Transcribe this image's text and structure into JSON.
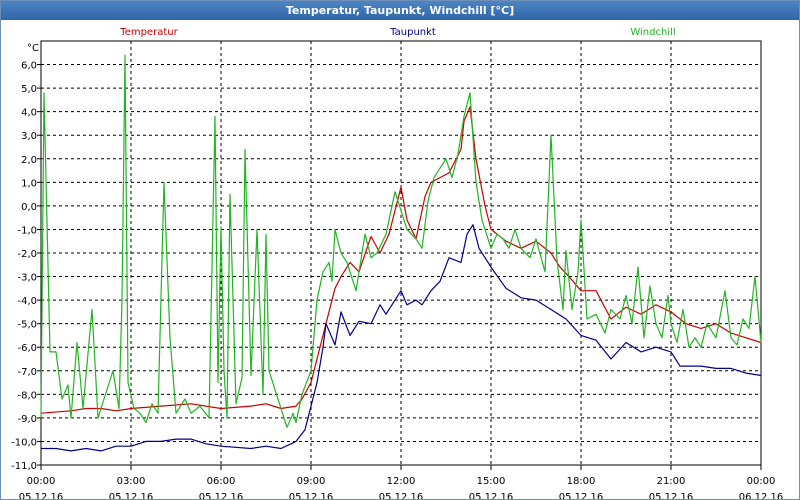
{
  "window": {
    "title": "Temperatur, Taupunkt, Windchill [°C]"
  },
  "chart_data": {
    "type": "line",
    "title": "Temperatur, Taupunkt, Windchill [°C]",
    "y_unit": "°C",
    "ylim": [
      -11,
      7
    ],
    "y_ticks": [
      "6,0",
      "5,0",
      "4,0",
      "3,0",
      "2,0",
      "1,0",
      "0,0",
      "-1,0",
      "-2,0",
      "-3,0",
      "-4,0",
      "-5,0",
      "-6,0",
      "-7,0",
      "-8,0",
      "-9,0",
      "-10,0",
      "-11,0"
    ],
    "y_tick_values": [
      6,
      5,
      4,
      3,
      2,
      1,
      0,
      -1,
      -2,
      -3,
      -4,
      -5,
      -6,
      -7,
      -8,
      -9,
      -10,
      -11
    ],
    "x_range_hours": [
      0,
      24
    ],
    "x_ticks": [
      {
        "hour": 0,
        "time": "00:00",
        "date": "05.12.16"
      },
      {
        "hour": 3,
        "time": "03:00",
        "date": "05.12.16"
      },
      {
        "hour": 6,
        "time": "06:00",
        "date": "05.12.16"
      },
      {
        "hour": 9,
        "time": "09:00",
        "date": "05.12.16"
      },
      {
        "hour": 12,
        "time": "12:00",
        "date": "05.12.16"
      },
      {
        "hour": 15,
        "time": "15:00",
        "date": "05.12.16"
      },
      {
        "hour": 18,
        "time": "18:00",
        "date": "05.12.16"
      },
      {
        "hour": 21,
        "time": "21:00",
        "date": "05.12.16"
      },
      {
        "hour": 24,
        "time": "00:00",
        "date": "06.12.16"
      }
    ],
    "grid": true,
    "legend_position": "top",
    "series": [
      {
        "name": "Temperatur",
        "color": "#cc0000",
        "points": [
          [
            0,
            -8.8
          ],
          [
            1,
            -8.7
          ],
          [
            1.5,
            -8.6
          ],
          [
            2,
            -8.6
          ],
          [
            2.5,
            -8.7
          ],
          [
            3,
            -8.6
          ],
          [
            4,
            -8.5
          ],
          [
            5,
            -8.4
          ],
          [
            6,
            -8.6
          ],
          [
            7,
            -8.5
          ],
          [
            7.5,
            -8.4
          ],
          [
            8,
            -8.6
          ],
          [
            8.5,
            -8.5
          ],
          [
            8.7,
            -8.2
          ],
          [
            9,
            -7.5
          ],
          [
            9.2,
            -6.5
          ],
          [
            9.5,
            -5
          ],
          [
            9.8,
            -3.5
          ],
          [
            10,
            -3
          ],
          [
            10.3,
            -2.4
          ],
          [
            10.6,
            -2.8
          ],
          [
            11,
            -1.3
          ],
          [
            11.3,
            -2
          ],
          [
            11.6,
            -1.2
          ],
          [
            12,
            0.8
          ],
          [
            12.2,
            -0.6
          ],
          [
            12.5,
            -1.4
          ],
          [
            12.8,
            0.4
          ],
          [
            13,
            1
          ],
          [
            13.3,
            1.2
          ],
          [
            13.6,
            1.4
          ],
          [
            14,
            2.4
          ],
          [
            14.1,
            3.6
          ],
          [
            14.3,
            4.2
          ],
          [
            14.5,
            2
          ],
          [
            14.8,
            0
          ],
          [
            15,
            -1
          ],
          [
            15.5,
            -1.5
          ],
          [
            16,
            -1.8
          ],
          [
            16.5,
            -1.5
          ],
          [
            17,
            -2
          ],
          [
            17.3,
            -2.6
          ],
          [
            17.6,
            -3
          ],
          [
            18,
            -3.6
          ],
          [
            18.5,
            -3.6
          ],
          [
            19,
            -4.8
          ],
          [
            19.5,
            -4.3
          ],
          [
            20,
            -4.6
          ],
          [
            20.5,
            -4.2
          ],
          [
            21,
            -4.5
          ],
          [
            21.5,
            -5
          ],
          [
            22,
            -5.2
          ],
          [
            22.5,
            -5
          ],
          [
            23,
            -5.4
          ],
          [
            23.5,
            -5.6
          ],
          [
            24,
            -5.8
          ]
        ]
      },
      {
        "name": "Taupunkt",
        "color": "#00008b",
        "points": [
          [
            0,
            -10.3
          ],
          [
            0.5,
            -10.3
          ],
          [
            1,
            -10.4
          ],
          [
            1.5,
            -10.3
          ],
          [
            2,
            -10.4
          ],
          [
            2.5,
            -10.2
          ],
          [
            3,
            -10.2
          ],
          [
            3.5,
            -10.0
          ],
          [
            4,
            -10.0
          ],
          [
            4.5,
            -9.9
          ],
          [
            5,
            -9.9
          ],
          [
            5.5,
            -10.1
          ],
          [
            6,
            -10.2
          ],
          [
            7,
            -10.3
          ],
          [
            7.5,
            -10.2
          ],
          [
            8,
            -10.3
          ],
          [
            8.5,
            -10.0
          ],
          [
            8.8,
            -9.5
          ],
          [
            9,
            -8.5
          ],
          [
            9.2,
            -7.5
          ],
          [
            9.4,
            -6
          ],
          [
            9.5,
            -5
          ],
          [
            9.8,
            -5.9
          ],
          [
            10,
            -4.5
          ],
          [
            10.3,
            -5.5
          ],
          [
            10.6,
            -4.9
          ],
          [
            11,
            -5
          ],
          [
            11.3,
            -4.2
          ],
          [
            11.5,
            -4.6
          ],
          [
            12,
            -3.6
          ],
          [
            12.2,
            -4.2
          ],
          [
            12.5,
            -4.0
          ],
          [
            12.7,
            -4.2
          ],
          [
            13,
            -3.6
          ],
          [
            13.3,
            -3.2
          ],
          [
            13.6,
            -2.2
          ],
          [
            14,
            -2.4
          ],
          [
            14.2,
            -1.2
          ],
          [
            14.4,
            -0.8
          ],
          [
            14.6,
            -1.8
          ],
          [
            15,
            -2.6
          ],
          [
            15.5,
            -3.5
          ],
          [
            16,
            -3.9
          ],
          [
            16.5,
            -4.0
          ],
          [
            17,
            -4.4
          ],
          [
            17.5,
            -4.8
          ],
          [
            18,
            -5.5
          ],
          [
            18.5,
            -5.7
          ],
          [
            19,
            -6.5
          ],
          [
            19.5,
            -5.8
          ],
          [
            20,
            -6.2
          ],
          [
            20.5,
            -6.0
          ],
          [
            21,
            -6.2
          ],
          [
            21.3,
            -6.8
          ],
          [
            21.5,
            -6.8
          ],
          [
            22,
            -6.8
          ],
          [
            22.5,
            -6.9
          ],
          [
            23,
            -6.9
          ],
          [
            23.5,
            -7.1
          ],
          [
            24,
            -7.2
          ]
        ]
      },
      {
        "name": "Windchill",
        "color": "#22b422",
        "points": [
          [
            0,
            -9
          ],
          [
            0.1,
            4.8
          ],
          [
            0.3,
            -6.2
          ],
          [
            0.5,
            -6.2
          ],
          [
            0.7,
            -8.2
          ],
          [
            0.9,
            -7.6
          ],
          [
            1,
            -9
          ],
          [
            1.2,
            -5.8
          ],
          [
            1.4,
            -8.6
          ],
          [
            1.7,
            -4.4
          ],
          [
            1.9,
            -9
          ],
          [
            2.1,
            -8.2
          ],
          [
            2.4,
            -7
          ],
          [
            2.6,
            -8.6
          ],
          [
            2.7,
            -4
          ],
          [
            2.8,
            6.4
          ],
          [
            2.9,
            -7.5
          ],
          [
            3.1,
            -8.6
          ],
          [
            3.3,
            -8.8
          ],
          [
            3.5,
            -9.2
          ],
          [
            3.7,
            -8.4
          ],
          [
            3.9,
            -8.8
          ],
          [
            4.1,
            1
          ],
          [
            4.3,
            -5.6
          ],
          [
            4.5,
            -8.8
          ],
          [
            4.8,
            -8.2
          ],
          [
            5,
            -8.8
          ],
          [
            5.3,
            -8.5
          ],
          [
            5.6,
            -9
          ],
          [
            5.8,
            3.8
          ],
          [
            5.9,
            -7.5
          ],
          [
            6,
            -0.9
          ],
          [
            6.1,
            -7
          ],
          [
            6.2,
            -9
          ],
          [
            6.3,
            0.5
          ],
          [
            6.5,
            -8.4
          ],
          [
            6.7,
            -7.3
          ],
          [
            6.8,
            2.4
          ],
          [
            7,
            -7.2
          ],
          [
            7.2,
            -1
          ],
          [
            7.4,
            -8
          ],
          [
            7.5,
            -1.2
          ],
          [
            7.6,
            -7
          ],
          [
            8,
            -8.6
          ],
          [
            8.2,
            -9.4
          ],
          [
            8.4,
            -8.8
          ],
          [
            8.5,
            -9.2
          ],
          [
            8.7,
            -8
          ],
          [
            9,
            -7
          ],
          [
            9.2,
            -4
          ],
          [
            9.4,
            -2.8
          ],
          [
            9.6,
            -2.4
          ],
          [
            9.7,
            -3.2
          ],
          [
            9.8,
            -1
          ],
          [
            10,
            -2
          ],
          [
            10.2,
            -2.4
          ],
          [
            10.5,
            -3.6
          ],
          [
            10.8,
            -1.2
          ],
          [
            11,
            -2.2
          ],
          [
            11.2,
            -2
          ],
          [
            11.5,
            -1.2
          ],
          [
            11.8,
            0.6
          ],
          [
            12,
            -0.2
          ],
          [
            12.2,
            -1
          ],
          [
            12.5,
            -1.4
          ],
          [
            12.7,
            -1.8
          ],
          [
            12.9,
            0.2
          ],
          [
            13.1,
            1.2
          ],
          [
            13.3,
            1.6
          ],
          [
            13.5,
            2
          ],
          [
            13.7,
            1.2
          ],
          [
            13.9,
            2.2
          ],
          [
            14.1,
            3.8
          ],
          [
            14.3,
            4.8
          ],
          [
            14.5,
            1
          ],
          [
            14.7,
            -0.6
          ],
          [
            15,
            -1.8
          ],
          [
            15.2,
            -1.2
          ],
          [
            15.4,
            -1.4
          ],
          [
            15.6,
            -1.8
          ],
          [
            15.8,
            -1
          ],
          [
            16,
            -1.8
          ],
          [
            16.3,
            -2.2
          ],
          [
            16.5,
            -1.4
          ],
          [
            16.8,
            -2.8
          ],
          [
            17,
            3
          ],
          [
            17.2,
            -2.3
          ],
          [
            17.4,
            -4.4
          ],
          [
            17.5,
            -1.9
          ],
          [
            17.7,
            -4.4
          ],
          [
            17.9,
            -2.8
          ],
          [
            18,
            -0.6
          ],
          [
            18.2,
            -4.8
          ],
          [
            18.5,
            -4.6
          ],
          [
            18.8,
            -5.4
          ],
          [
            19,
            -4.4
          ],
          [
            19.3,
            -4.8
          ],
          [
            19.5,
            -3.8
          ],
          [
            19.7,
            -5
          ],
          [
            19.9,
            -2.6
          ],
          [
            20.1,
            -5.6
          ],
          [
            20.3,
            -3.4
          ],
          [
            20.5,
            -5
          ],
          [
            20.7,
            -5.6
          ],
          [
            20.9,
            -3.8
          ],
          [
            21,
            -5
          ],
          [
            21.2,
            -5.8
          ],
          [
            21.4,
            -4.4
          ],
          [
            21.6,
            -6
          ],
          [
            21.8,
            -5.6
          ],
          [
            22,
            -6
          ],
          [
            22.2,
            -5
          ],
          [
            22.5,
            -5.6
          ],
          [
            22.8,
            -3.6
          ],
          [
            23,
            -5.6
          ],
          [
            23.2,
            -5.9
          ],
          [
            23.4,
            -4.8
          ],
          [
            23.6,
            -5.2
          ],
          [
            23.8,
            -3
          ],
          [
            24,
            -5.8
          ]
        ]
      }
    ]
  }
}
